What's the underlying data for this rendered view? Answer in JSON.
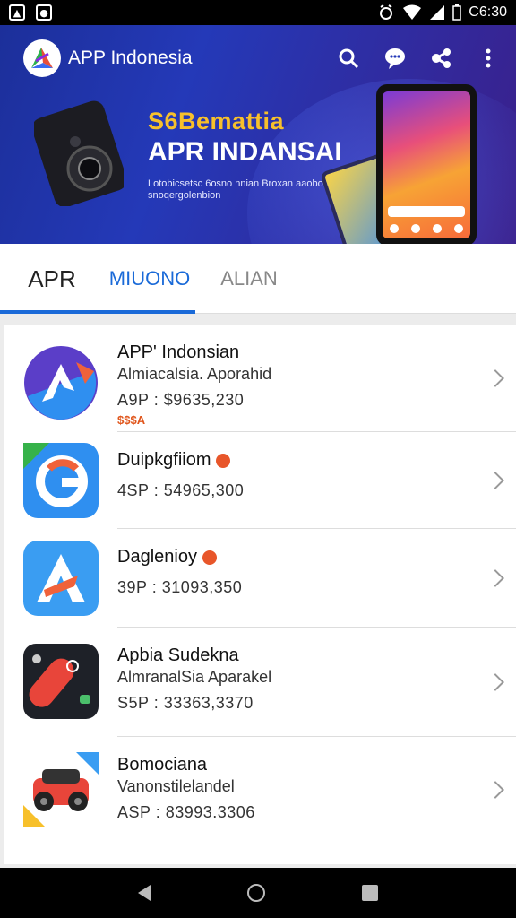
{
  "status_bar": {
    "left_icons": [
      "image-icon",
      "photo-icon"
    ],
    "time": "C6:30",
    "right_icons": [
      "alarm-icon",
      "wifi-icon",
      "signal-icon",
      "battery-icon"
    ]
  },
  "header": {
    "title": "APP Indonesia",
    "actions": [
      "search-icon",
      "chat-icon",
      "share-icon",
      "more-vert-icon"
    ]
  },
  "banner": {
    "headline_1": "S6Bemattia",
    "headline_2": "APR INDANSAI",
    "tagline": "Lotobicsetsc 6osno nnian Broxan aaobonvasjes snoqergolenbion",
    "colors": {
      "headline_1": "#f7c02b",
      "background": "#2439b8"
    }
  },
  "tabs": [
    {
      "label": "APR",
      "selected": true
    },
    {
      "label": "MIUONO",
      "selected": false
    },
    {
      "label": "ALIAN",
      "selected": false
    }
  ],
  "apps": [
    {
      "name": "APP' Indonsian",
      "subtitle": "Almiacalsia. Aporahid",
      "price": "A9P : $9635,230",
      "promo": "$$$A",
      "badge": false,
      "icon": "app-a-icon"
    },
    {
      "name": "Duipkgfiiom",
      "subtitle": "",
      "price": "4SP : 54965,300",
      "promo": "",
      "badge": true,
      "icon": "g-icon"
    },
    {
      "name": "Daglenioy",
      "subtitle": "",
      "price": "39P : 31093,350",
      "promo": "",
      "badge": true,
      "icon": "a-arrow-icon"
    },
    {
      "name": "Apbia Sudekna",
      "subtitle": "AlmranalSia Aparakel",
      "price": "S5P : 33363,3370",
      "promo": "",
      "badge": false,
      "icon": "skate-icon"
    },
    {
      "name": "Bomociana",
      "subtitle": "Vanonstilelandel",
      "price": "ASP : 83993.3306",
      "promo": "",
      "badge": false,
      "icon": "car-icon"
    }
  ],
  "navbar": [
    "back-icon",
    "home-icon",
    "recents-icon"
  ]
}
